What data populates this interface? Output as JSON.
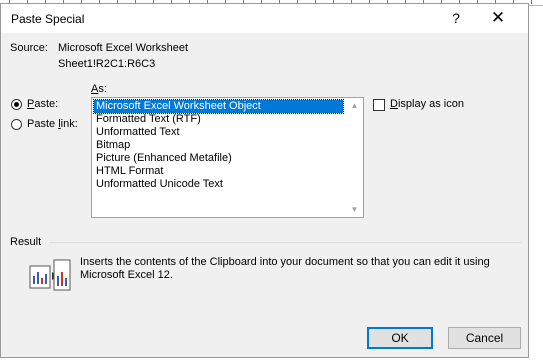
{
  "window": {
    "title": "Paste Special",
    "help_glyph": "?",
    "close_glyph": "✕"
  },
  "source": {
    "label": "Source:",
    "name": "Microsoft Excel Worksheet",
    "range": "Sheet1!R2C1:R6C3"
  },
  "as_label": "As:",
  "paste_options": {
    "paste": {
      "label": "Paste:",
      "checked": true
    },
    "paste_link": {
      "label": "Paste link:",
      "checked": false
    }
  },
  "formats": [
    "Microsoft Excel Worksheet Object",
    "Formatted Text (RTF)",
    "Unformatted Text",
    "Bitmap",
    "Picture (Enhanced Metafile)",
    "HTML Format",
    "Unformatted Unicode Text"
  ],
  "selected_format": "Microsoft Excel Worksheet Object",
  "display_as_icon": {
    "label": "Display as icon",
    "checked": false
  },
  "result": {
    "label": "Result",
    "line1": "Inserts the contents of the Clipboard into your document so that you can edit it using",
    "line2": "Microsoft Excel 12."
  },
  "buttons": {
    "ok": "OK",
    "cancel": "Cancel"
  },
  "colors": {
    "selection": "#0078d7",
    "dialog_bg": "#f0f0f0"
  }
}
